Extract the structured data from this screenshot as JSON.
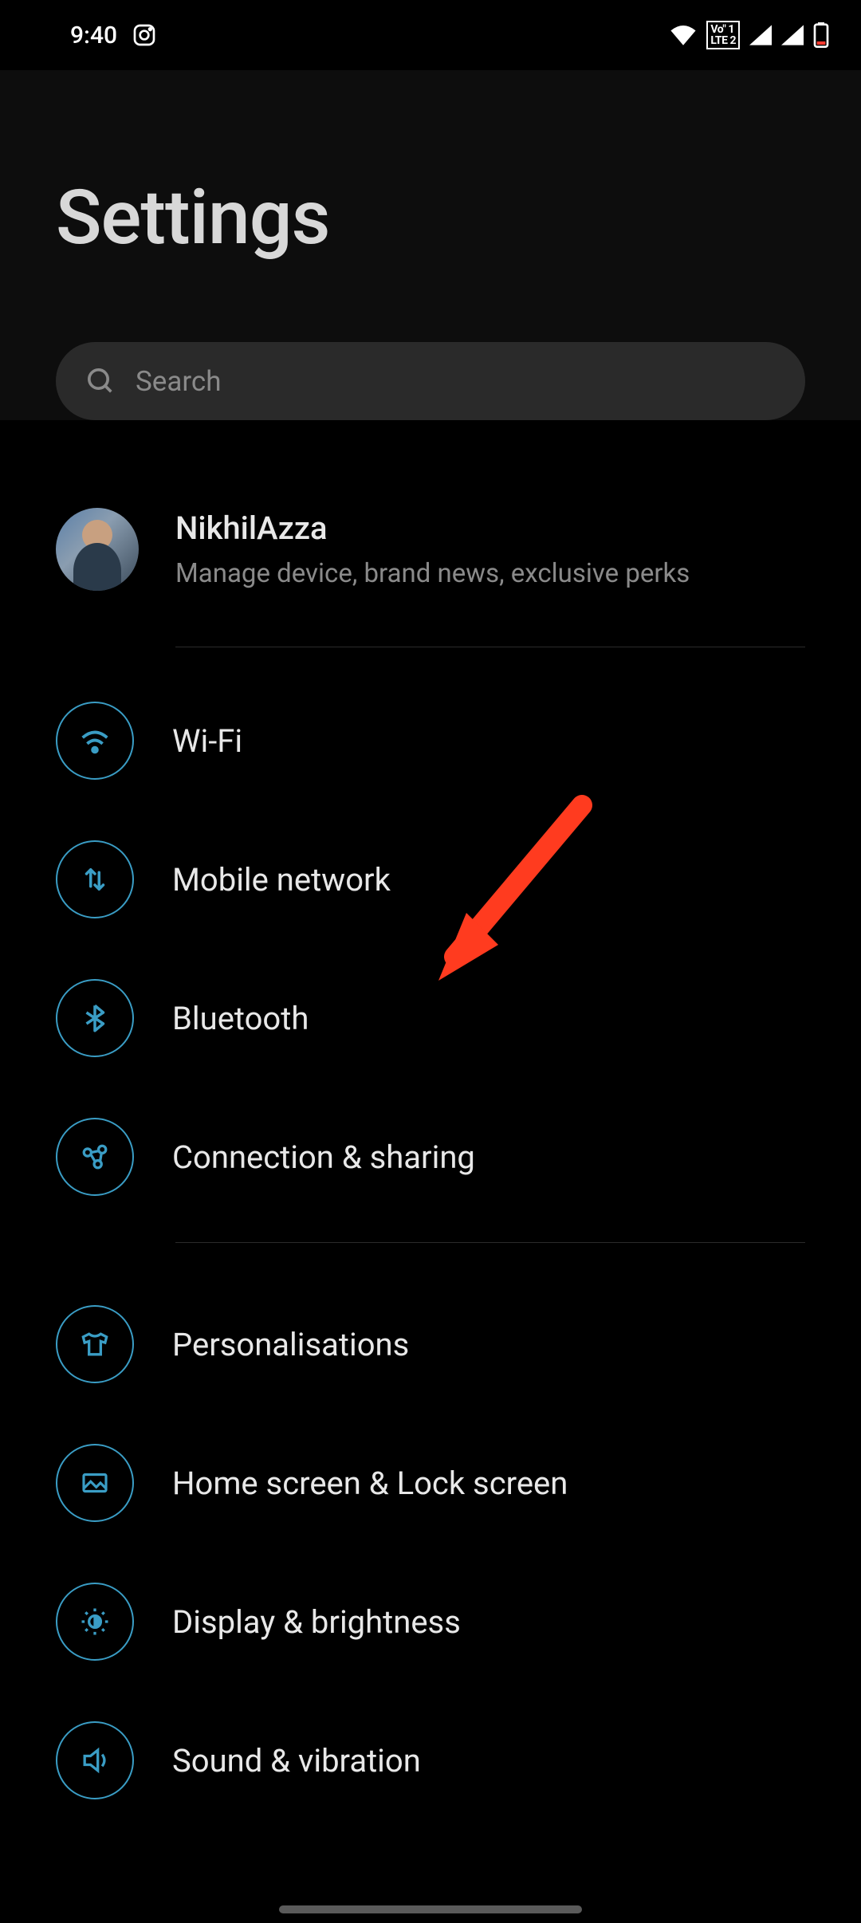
{
  "status": {
    "time": "9:40",
    "volte_line1": "Vo\" 1",
    "volte_line2": "LTE 2"
  },
  "header": {
    "title": "Settings",
    "search_placeholder": "Search"
  },
  "account": {
    "name": "NikhilAzza",
    "subtitle": "Manage device, brand news, exclusive perks"
  },
  "groups": [
    {
      "items": [
        {
          "id": "wifi",
          "label": "Wi-Fi",
          "icon": "wifi-icon"
        },
        {
          "id": "mobile-network",
          "label": "Mobile network",
          "icon": "mobile-data-icon"
        },
        {
          "id": "bluetooth",
          "label": "Bluetooth",
          "icon": "bluetooth-icon"
        },
        {
          "id": "connection-sharing",
          "label": "Connection & sharing",
          "icon": "share-icon"
        }
      ]
    },
    {
      "items": [
        {
          "id": "personalisations",
          "label": "Personalisations",
          "icon": "tshirt-icon"
        },
        {
          "id": "home-lock-screen",
          "label": "Home screen & Lock screen",
          "icon": "image-icon"
        },
        {
          "id": "display-brightness",
          "label": "Display & brightness",
          "icon": "brightness-icon"
        },
        {
          "id": "sound-vibration",
          "label": "Sound & vibration",
          "icon": "sound-icon"
        }
      ]
    }
  ],
  "annotation": {
    "target": "mobile-network",
    "color": "#ff3b1f"
  }
}
